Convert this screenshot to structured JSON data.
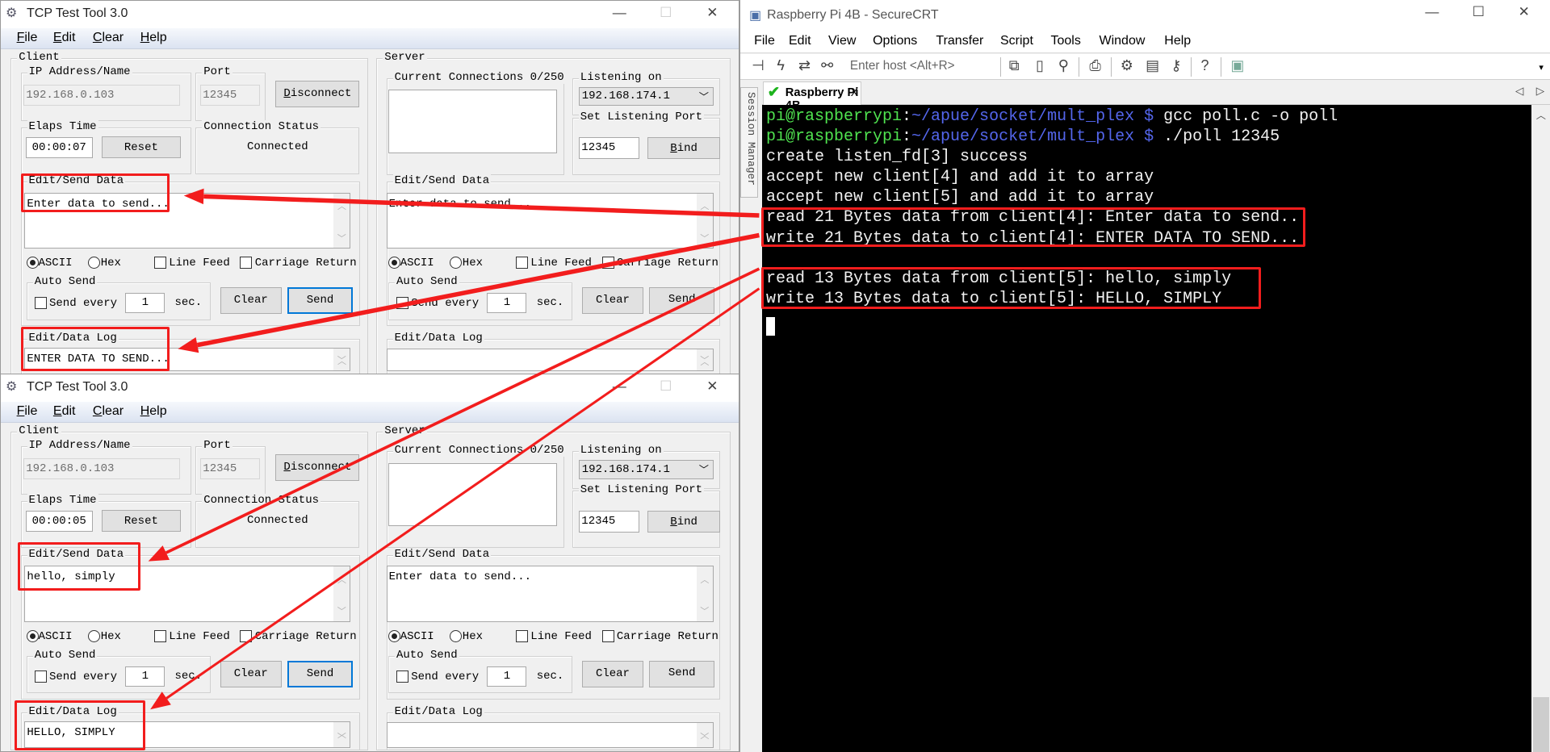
{
  "windows": [
    {
      "title": "TCP Test Tool 3.0",
      "menu": [
        "File",
        "Edit",
        "Clear",
        "Help"
      ],
      "client": {
        "label": "Client",
        "ip_label": "IP Address/Name",
        "ip_value": "192.168.0.103",
        "port_label": "Port",
        "port_value": "12345",
        "disconnect": "Disconnect",
        "elaps_label": "Elaps Time",
        "elaps_value": "00:00:07",
        "reset": "Reset",
        "status_label": "Connection Status",
        "status_value": "Connected",
        "send_label": "Edit/Send Data",
        "send_text": "Enter data to send...",
        "ascii": "ASCII",
        "hex": "Hex",
        "line_feed": "Line Feed",
        "carriage_return": "Carriage Return",
        "auto_send": "Auto Send",
        "send_every": "Send every",
        "interval": "1",
        "sec": "sec.",
        "clear": "Clear",
        "send": "Send",
        "log_label": "Edit/Data Log",
        "log_text": "ENTER DATA TO SEND..."
      },
      "server": {
        "label": "Server",
        "connections_label": "Current Connections 0/250",
        "listening_label": "Listening on",
        "listening_value": "192.168.174.1",
        "set_port_label": "Set Listening Port",
        "port_value": "12345",
        "bind": "Bind",
        "send_label": "Edit/Send Data",
        "send_text": "Enter data to send...",
        "ascii": "ASCII",
        "hex": "Hex",
        "line_feed": "Line Feed",
        "carriage_return": "Carriage Return",
        "auto_send": "Auto Send",
        "send_every": "Send every",
        "interval": "1",
        "sec": "sec.",
        "clear": "Clear",
        "send": "Send",
        "log_label": "Edit/Data Log",
        "log_text": ""
      }
    },
    {
      "title": "TCP Test Tool 3.0",
      "menu": [
        "File",
        "Edit",
        "Clear",
        "Help"
      ],
      "client": {
        "label": "Client",
        "ip_label": "IP Address/Name",
        "ip_value": "192.168.0.103",
        "port_label": "Port",
        "port_value": "12345",
        "disconnect": "Disconnect",
        "elaps_label": "Elaps Time",
        "elaps_value": "00:00:05",
        "reset": "Reset",
        "status_label": "Connection Status",
        "status_value": "Connected",
        "send_label": "Edit/Send Data",
        "send_text": "hello, simply",
        "ascii": "ASCII",
        "hex": "Hex",
        "line_feed": "Line Feed",
        "carriage_return": "Carriage Return",
        "auto_send": "Auto Send",
        "send_every": "Send every",
        "interval": "1",
        "sec": "sec.",
        "clear": "Clear",
        "send": "Send",
        "log_label": "Edit/Data Log",
        "log_text": "HELLO, SIMPLY"
      },
      "server": {
        "label": "Server",
        "connections_label": "Current Connections 0/250",
        "listening_label": "Listening on",
        "listening_value": "192.168.174.1",
        "set_port_label": "Set Listening Port",
        "port_value": "12345",
        "bind": "Bind",
        "send_label": "Edit/Send Data",
        "send_text": "Enter data to send...",
        "ascii": "ASCII",
        "hex": "Hex",
        "line_feed": "Line Feed",
        "carriage_return": "Carriage Return",
        "auto_send": "Auto Send",
        "send_every": "Send every",
        "interval": "1",
        "sec": "sec.",
        "clear": "Clear",
        "send": "Send",
        "log_label": "Edit/Data Log",
        "log_text": ""
      }
    }
  ],
  "securecrt": {
    "title": "Raspberry Pi 4B - SecureCRT",
    "menu": [
      "File",
      "Edit",
      "View",
      "Options",
      "Transfer",
      "Script",
      "Tools",
      "Window",
      "Help"
    ],
    "toolbar": {
      "host_placeholder": "Enter host <Alt+R>",
      "icons": [
        "connect-icon",
        "quick-connect-icon",
        "reconnect-icon",
        "disconnect-icon",
        "copy-icon",
        "paste-icon",
        "find-icon",
        "print-icon",
        "settings-icon",
        "keymap-icon",
        "key-icon",
        "help-icon",
        "sftp-icon"
      ]
    },
    "session_manager": "Session Manager",
    "tab": {
      "label": "Raspberry Pi 4B",
      "close": "X"
    },
    "terminal": {
      "prompt_user": "pi@raspberrypi",
      "prompt_sep": ":",
      "prompt_path": "~/apue/socket/mult_plex $",
      "commands": [
        " gcc poll.c -o poll",
        " ./poll 12345"
      ],
      "output": [
        "create listen_fd[3] success",
        "accept new client[4] and add it to array",
        "accept new client[5] and add it to array",
        "read 21 Bytes data from client[4]: Enter data to send..",
        "write 21 Bytes data to client[4]: ENTER DATA TO SEND...",
        "",
        "read 13 Bytes data from client[5]: hello, simply",
        "write 13 Bytes data to client[5]: HELLO, SIMPLY"
      ],
      "colors": {
        "user": "#4fe24f",
        "path": "#5466ec",
        "text": "#f2f2f2",
        "background": "#000000"
      }
    }
  },
  "annotation_color": "#f21d1d"
}
